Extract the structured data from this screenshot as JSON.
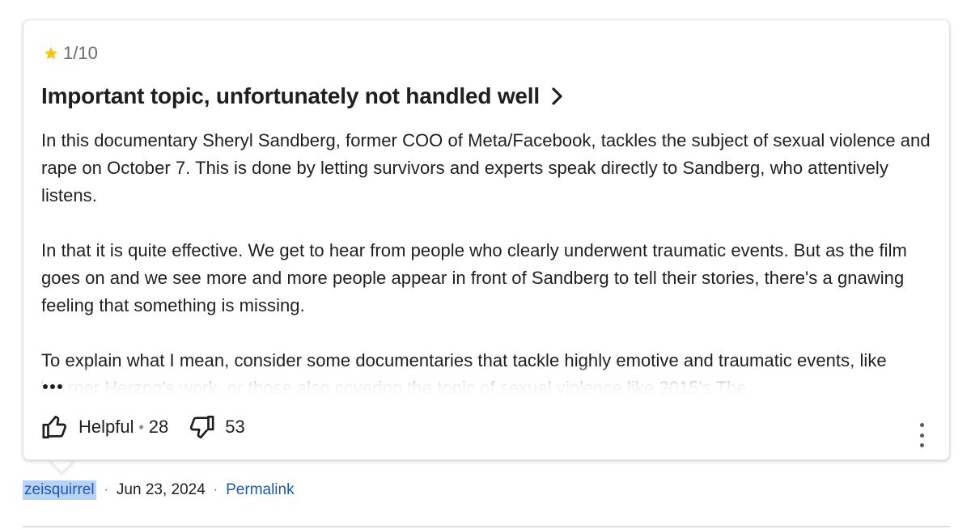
{
  "review": {
    "rating": "1/10",
    "title": "Important topic, unfortunately not handled well",
    "paragraphs": [
      "In this documentary Sheryl Sandberg, former COO of Meta/Facebook, tackles the subject of sexual violence and rape on October 7. This is done by letting survivors and experts speak directly to Sandberg, who attentively listens.",
      "In that it is quite effective. We get to hear from people who clearly underwent traumatic events. But as the film goes on and we see more and more people appear in front of Sandberg to tell their stories, there's a gnawing feeling that something is missing.",
      "To explain what I mean, consider some documentaries that tackle highly emotive and traumatic events, like Werner Herzog's work, or those also covering the topic of sexual violence like 2015's The"
    ]
  },
  "actions": {
    "helpful_label": "Helpful",
    "helpful_count": "28",
    "not_helpful_count": "53"
  },
  "meta": {
    "author": "zeisquirrel",
    "date": "Jun 23, 2024",
    "permalink": "Permalink",
    "separator": "·"
  },
  "colors": {
    "star": "#f5c518",
    "link": "#1e57b6",
    "highlight": "#b8d3f5"
  },
  "icons": [
    "star-icon",
    "chevron-right-icon",
    "more-dots-icon",
    "thumbs-up-icon",
    "thumbs-down-icon",
    "kebab-menu-icon"
  ]
}
